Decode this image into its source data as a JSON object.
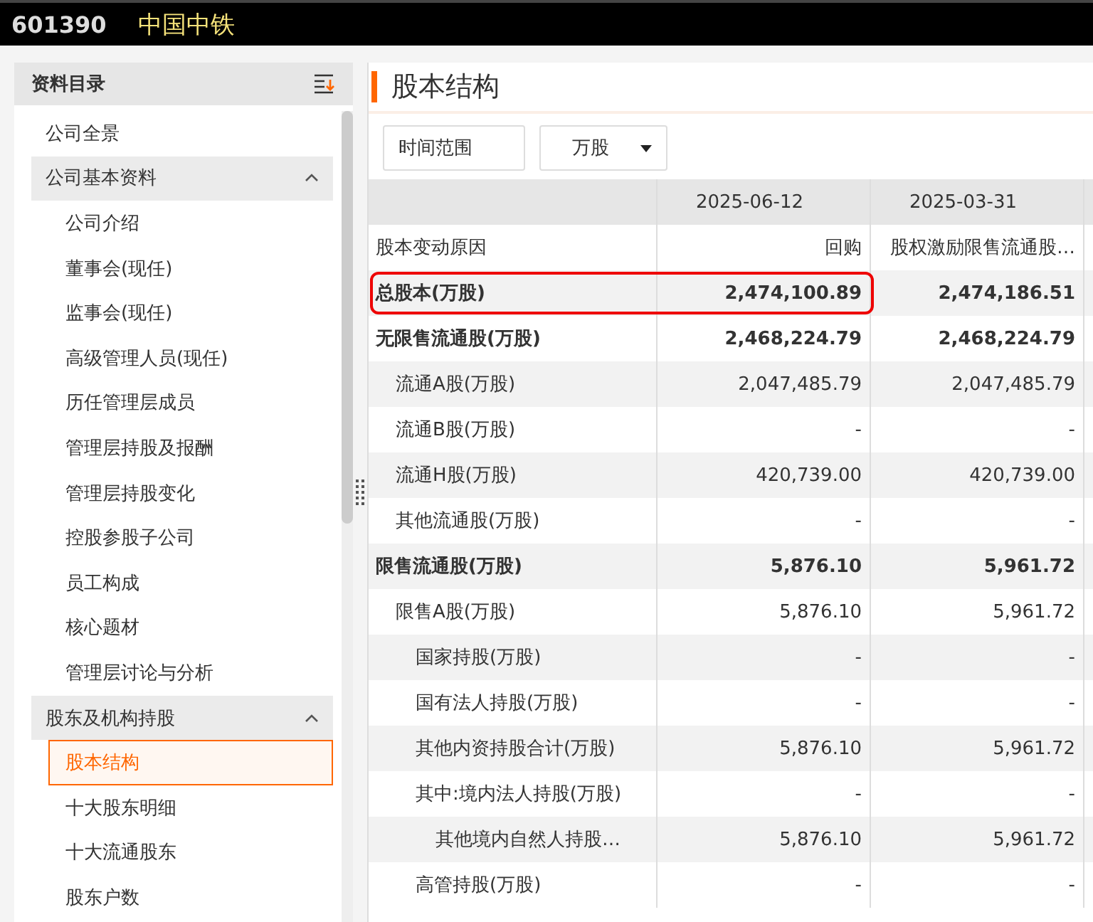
{
  "header": {
    "code": "601390",
    "name": "中国中铁"
  },
  "sidebar": {
    "title": "资料目录",
    "items": [
      {
        "label": "公司全景",
        "selected": false
      },
      {
        "label": "公司基本资料",
        "expanded": true,
        "selected": false,
        "children": [
          {
            "label": "公司介绍",
            "selected": false
          },
          {
            "label": "董事会(现任)",
            "selected": false
          },
          {
            "label": "监事会(现任)",
            "selected": false
          },
          {
            "label": "高级管理人员(现任)",
            "selected": false
          },
          {
            "label": "历任管理层成员",
            "selected": false
          },
          {
            "label": "管理层持股及报酬",
            "selected": false
          },
          {
            "label": "管理层持股变化",
            "selected": false
          },
          {
            "label": "控股参股子公司",
            "selected": false
          },
          {
            "label": "员工构成",
            "selected": false
          },
          {
            "label": "核心题材",
            "selected": false
          },
          {
            "label": "管理层讨论与分析",
            "selected": false
          }
        ]
      },
      {
        "label": "股东及机构持股",
        "expanded": true,
        "selected": false,
        "children": [
          {
            "label": "股本结构",
            "selected": true
          },
          {
            "label": "十大股东明细",
            "selected": false
          },
          {
            "label": "十大流通股东",
            "selected": false
          },
          {
            "label": "股东户数",
            "selected": false
          }
        ]
      }
    ]
  },
  "main": {
    "title": "股本结构",
    "filters": [
      {
        "kind": "button",
        "label": "时间范围"
      },
      {
        "kind": "dropdown",
        "label": "万股"
      }
    ],
    "table": {
      "columns": [
        "2025-06-12",
        "2025-03-31"
      ],
      "rows": [
        {
          "label": "股本变动原因",
          "bold": false,
          "highlighted": false,
          "values": [
            "回购",
            "股权激励限售流通股…"
          ]
        },
        {
          "label": "总股本(万股)",
          "bold": true,
          "highlighted": true,
          "values": [
            "2,474,100.89",
            "2,474,186.51"
          ]
        },
        {
          "label": "无限售流通股(万股)",
          "bold": true,
          "highlighted": false,
          "values": [
            "2,468,224.79",
            "2,468,224.79"
          ],
          "children": [
            {
              "label": "流通A股(万股)",
              "bold": false,
              "highlighted": false,
              "values": [
                "2,047,485.79",
                "2,047,485.79"
              ]
            },
            {
              "label": "流通B股(万股)",
              "bold": false,
              "highlighted": false,
              "values": [
                "-",
                "-"
              ]
            },
            {
              "label": "流通H股(万股)",
              "bold": false,
              "highlighted": false,
              "values": [
                "420,739.00",
                "420,739.00"
              ]
            },
            {
              "label": "其他流通股(万股)",
              "bold": false,
              "highlighted": false,
              "values": [
                "-",
                "-"
              ]
            }
          ]
        },
        {
          "label": "限售流通股(万股)",
          "bold": true,
          "highlighted": false,
          "values": [
            "5,876.10",
            "5,961.72"
          ],
          "children": [
            {
              "label": "限售A股(万股)",
              "bold": false,
              "highlighted": false,
              "values": [
                "5,876.10",
                "5,961.72"
              ],
              "children": [
                {
                  "label": "国家持股(万股)",
                  "bold": false,
                  "highlighted": false,
                  "values": [
                    "-",
                    "-"
                  ]
                },
                {
                  "label": "国有法人持股(万股)",
                  "bold": false,
                  "highlighted": false,
                  "values": [
                    "-",
                    "-"
                  ]
                },
                {
                  "label": "其他内资持股合计(万股)",
                  "bold": false,
                  "highlighted": false,
                  "values": [
                    "5,876.10",
                    "5,961.72"
                  ]
                },
                {
                  "label": "其中:境内法人持股(万股)",
                  "bold": false,
                  "highlighted": false,
                  "values": [
                    "-",
                    "-"
                  ],
                  "children": [
                    {
                      "label": "其他境内自然人持股…",
                      "bold": false,
                      "highlighted": false,
                      "values": [
                        "5,876.10",
                        "5,961.72"
                      ]
                    }
                  ]
                },
                {
                  "label": "高管持股(万股)",
                  "bold": false,
                  "highlighted": false,
                  "values": [
                    "-",
                    "-"
                  ]
                }
              ]
            }
          ]
        }
      ]
    }
  }
}
